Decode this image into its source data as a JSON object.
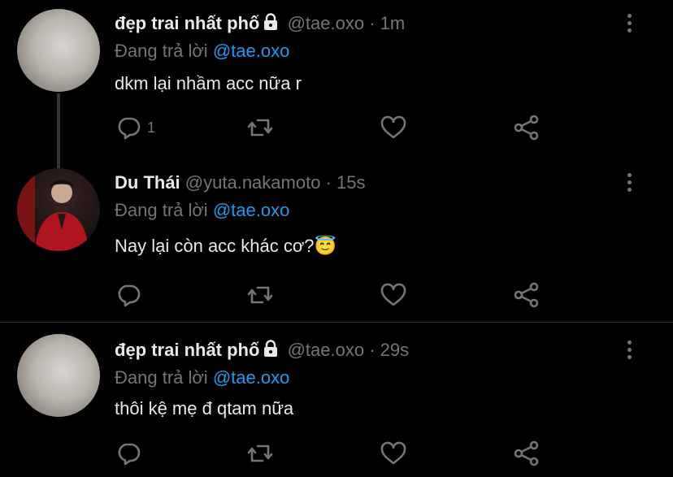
{
  "tweets": [
    {
      "name": "đẹp trai nhất phố",
      "locked": true,
      "handle": "@tae.oxo",
      "dot": "·",
      "time": "1m",
      "reply_prefix": "Đang trả lời",
      "reply_to": "@tae.oxo",
      "text": "dkm lại nhầm acc nữa r",
      "reply_count": "1"
    },
    {
      "name": "Du Thái",
      "locked": false,
      "handle": "@yuta.nakamoto",
      "dot": "·",
      "time": "15s",
      "reply_prefix": "Đang trả lời",
      "reply_to": "@tae.oxo",
      "text": "Nay lại còn acc khác cơ?😇",
      "reply_count": ""
    },
    {
      "name": "đẹp trai nhất phố",
      "locked": true,
      "handle": "@tae.oxo",
      "dot": "·",
      "time": "29s",
      "reply_prefix": "Đang trả lời",
      "reply_to": "@tae.oxo",
      "text": "thôi kệ mẹ đ qtam nữa",
      "reply_count": ""
    }
  ],
  "icons": {
    "reply": "reply-icon",
    "retweet": "retweet-icon",
    "like": "heart-icon",
    "share": "share-icon",
    "more": "more-vertical-icon",
    "lock": "lock-icon"
  },
  "colors": {
    "background": "#000000",
    "text": "#e7e9ea",
    "muted": "#71767b",
    "mention": "#1d9bf0"
  }
}
